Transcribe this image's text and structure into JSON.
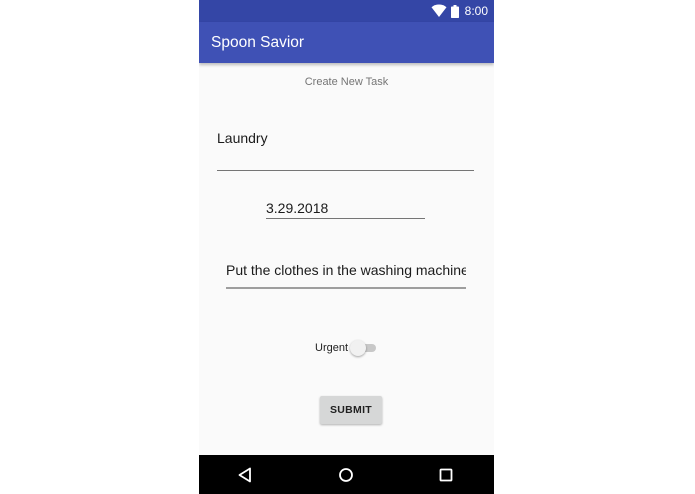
{
  "status_bar": {
    "time": "8:00",
    "wifi_icon": "wifi-icon",
    "battery_icon": "battery-icon",
    "color": "#3446a6"
  },
  "app_bar": {
    "title": "Spoon Savior",
    "color": "#3f51b5"
  },
  "form": {
    "subtitle": "Create New Task",
    "task_name_value": "Laundry",
    "due_date_value": "3.29.2018",
    "description_value": "Put the clothes in the washing machine",
    "urgent_label": "Urgent",
    "urgent_on": false,
    "submit_label": "SUBMIT"
  },
  "nav_bar": {
    "back_icon": "back-triangle-icon",
    "home_icon": "home-circle-icon",
    "recents_icon": "recents-square-icon"
  }
}
